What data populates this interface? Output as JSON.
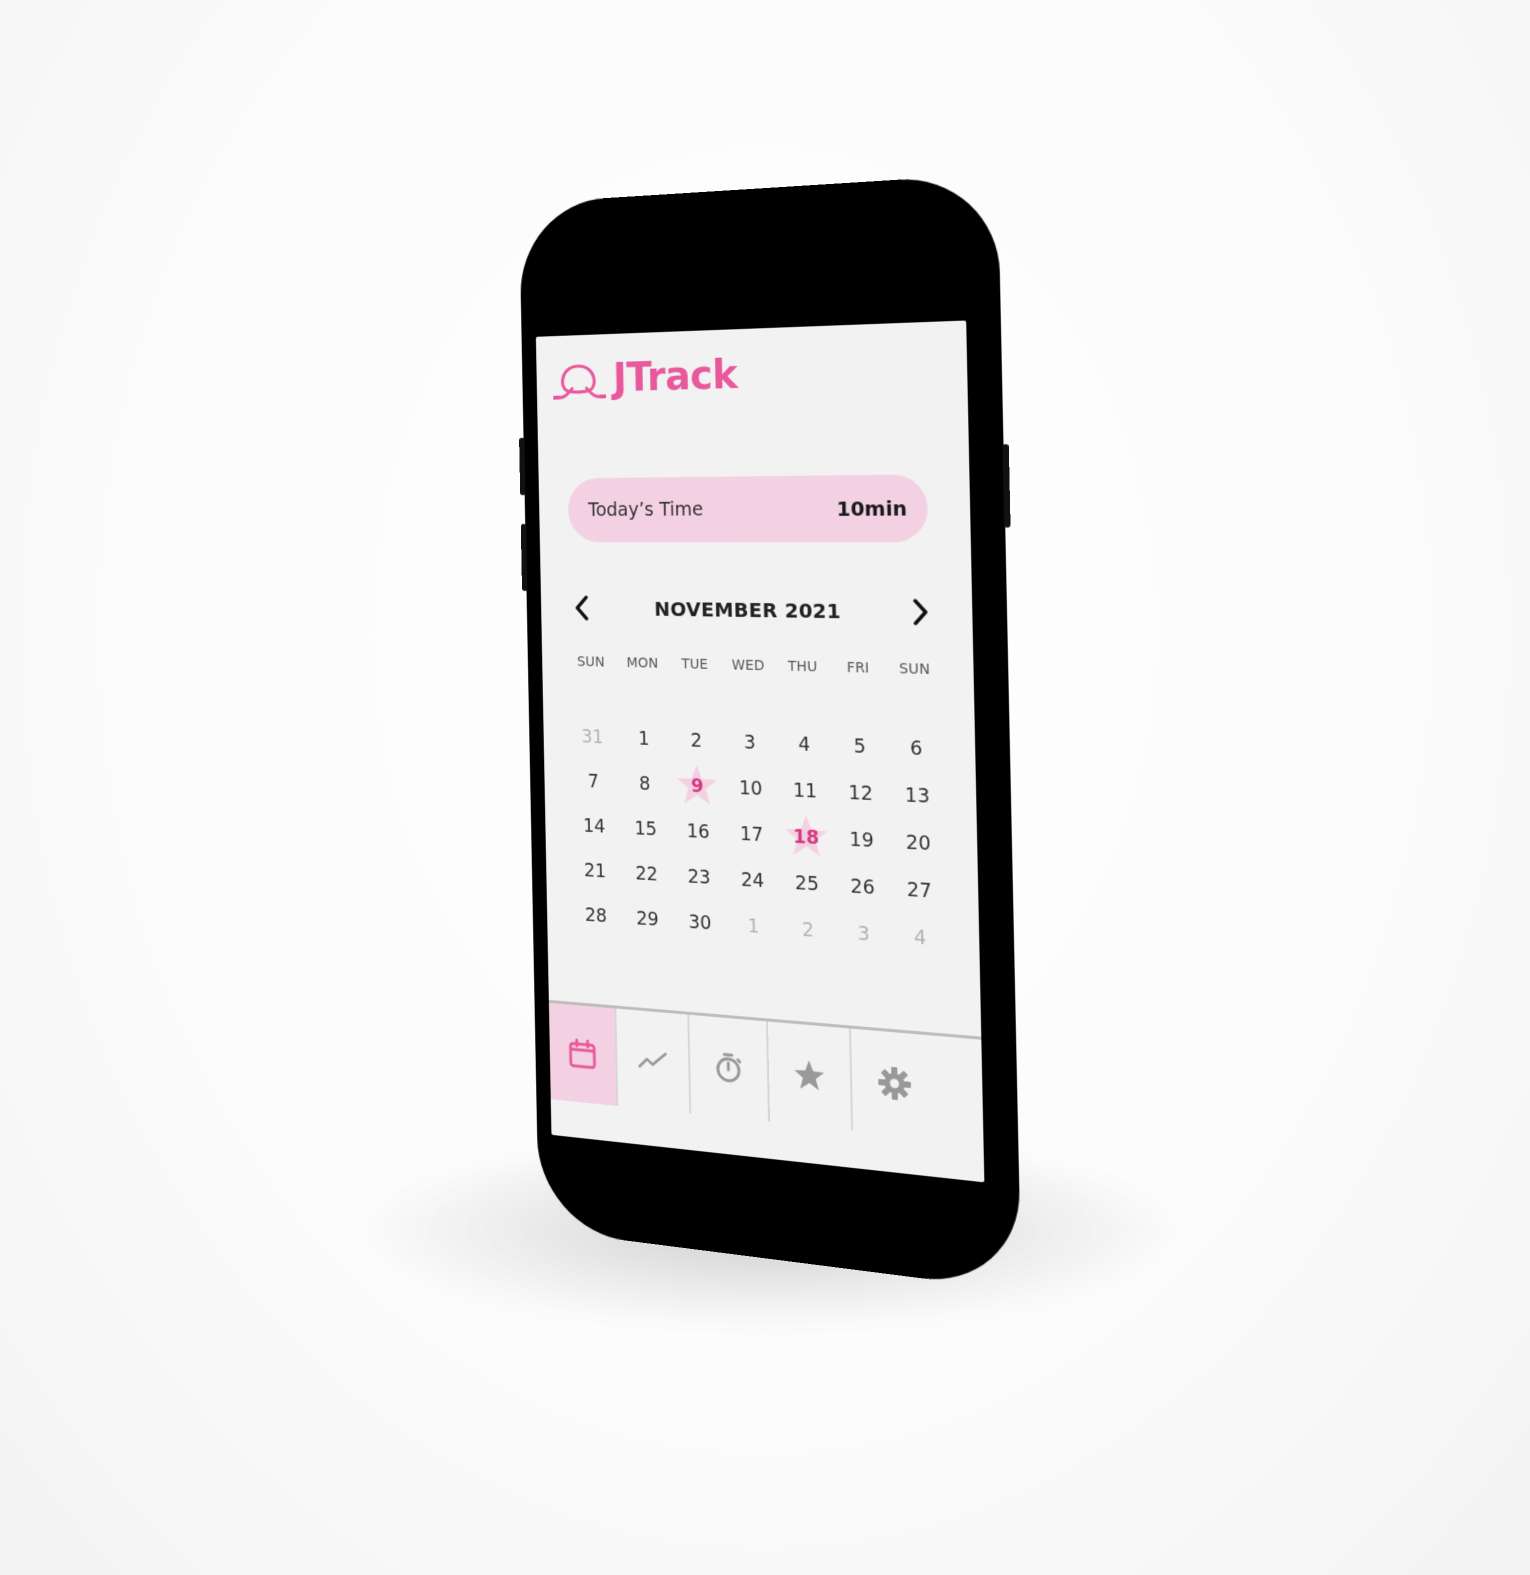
{
  "app": {
    "name": "JTrack",
    "brand_color": "#e8589b",
    "accent_light": "#f3d1e2"
  },
  "today": {
    "label": "Today’s Time",
    "value": "10min"
  },
  "calendar": {
    "month_title": "NOVEMBER 2021",
    "prev_icon": "chevron-left-icon",
    "next_icon": "chevron-right-icon",
    "weekdays": [
      "SUN",
      "MON",
      "TUE",
      "WED",
      "THU",
      "FRI",
      "SUN"
    ],
    "days": [
      {
        "d": "31",
        "muted": true
      },
      {
        "d": "1"
      },
      {
        "d": "2"
      },
      {
        "d": "3"
      },
      {
        "d": "4"
      },
      {
        "d": "5"
      },
      {
        "d": "6"
      },
      {
        "d": "7"
      },
      {
        "d": "8"
      },
      {
        "d": "9",
        "marked": true
      },
      {
        "d": "10"
      },
      {
        "d": "11"
      },
      {
        "d": "12"
      },
      {
        "d": "13"
      },
      {
        "d": "14"
      },
      {
        "d": "15"
      },
      {
        "d": "16"
      },
      {
        "d": "17"
      },
      {
        "d": "18",
        "marked": true
      },
      {
        "d": "19"
      },
      {
        "d": "20"
      },
      {
        "d": "21"
      },
      {
        "d": "22"
      },
      {
        "d": "23"
      },
      {
        "d": "24"
      },
      {
        "d": "25"
      },
      {
        "d": "26"
      },
      {
        "d": "27"
      },
      {
        "d": "28"
      },
      {
        "d": "29"
      },
      {
        "d": "30"
      },
      {
        "d": "1",
        "muted": true
      },
      {
        "d": "2",
        "muted": true
      },
      {
        "d": "3",
        "muted": true
      },
      {
        "d": "4",
        "muted": true
      }
    ]
  },
  "tabs": [
    {
      "name": "calendar",
      "icon": "calendar-icon",
      "active": true
    },
    {
      "name": "stats",
      "icon": "trend-line-icon",
      "active": false
    },
    {
      "name": "timer",
      "icon": "stopwatch-icon",
      "active": false
    },
    {
      "name": "favorites",
      "icon": "star-icon",
      "active": false
    },
    {
      "name": "settings",
      "icon": "gear-icon",
      "active": false
    }
  ]
}
